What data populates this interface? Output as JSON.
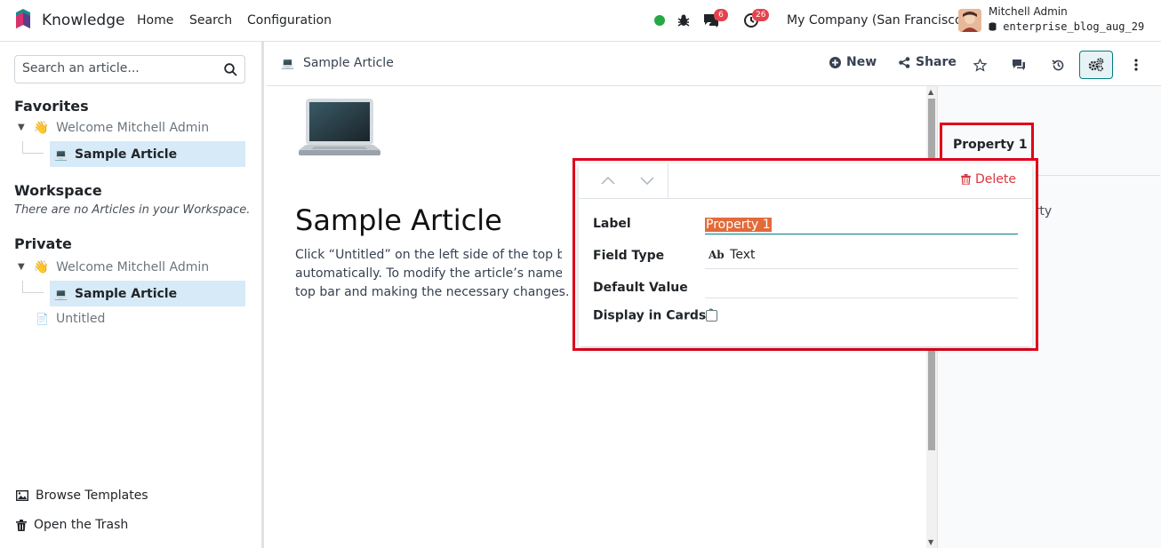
{
  "topbar": {
    "app_name": "Knowledge",
    "nav": [
      "Home",
      "Search",
      "Configuration"
    ],
    "messages_count": "6",
    "activities_count": "26",
    "company": "My Company (San Francisco)",
    "user_name": "Mitchell Admin",
    "db_name": "enterprise_blog_aug_29",
    "status_color": "#28a745"
  },
  "sidebar": {
    "search_placeholder": "Search an article...",
    "favorites_title": "Favorites",
    "favorites": [
      {
        "emoji": "👋",
        "label": "Welcome Mitchell Admin"
      },
      {
        "emoji": "💻",
        "label": "Sample Article"
      }
    ],
    "workspace_title": "Workspace",
    "workspace_empty": "There are no Articles in your Workspace.",
    "private_title": "Private",
    "private": [
      {
        "emoji": "👋",
        "label": "Welcome Mitchell Admin"
      },
      {
        "emoji": "💻",
        "label": "Sample Article"
      },
      {
        "emoji": "📄",
        "label": "Untitled"
      }
    ],
    "browse_templates": "Browse Templates",
    "open_trash": "Open the Trash"
  },
  "control_bar": {
    "breadcrumb_emoji": "💻",
    "breadcrumb_title": "Sample Article",
    "new_label": "New",
    "share_label": "Share"
  },
  "article": {
    "emoji": "💻",
    "title": "Sample Article",
    "body_lines": [
      "Click “Untitled” on the left side of the top bar to h",
      "automatically. To modify the article’s name later, ",
      "top bar and making the necessary changes."
    ]
  },
  "properties_panel": {
    "tab_label": "Property 1",
    "behind_text": "erty"
  },
  "popover": {
    "delete_label": "Delete",
    "label_label": "Label",
    "label_value": "Property 1",
    "field_type_label": "Field Type",
    "field_type_icon_text": "Ab",
    "field_type_value": "Text",
    "default_value_label": "Default Value",
    "display_in_cards_label": "Display in Cards",
    "help_mark": "?",
    "display_in_cards_checked": false
  },
  "colors": {
    "accent": "#017e84",
    "highlight_red": "#e0001a",
    "badge_red": "#e4424d",
    "active_row": "#d6eaf8"
  }
}
